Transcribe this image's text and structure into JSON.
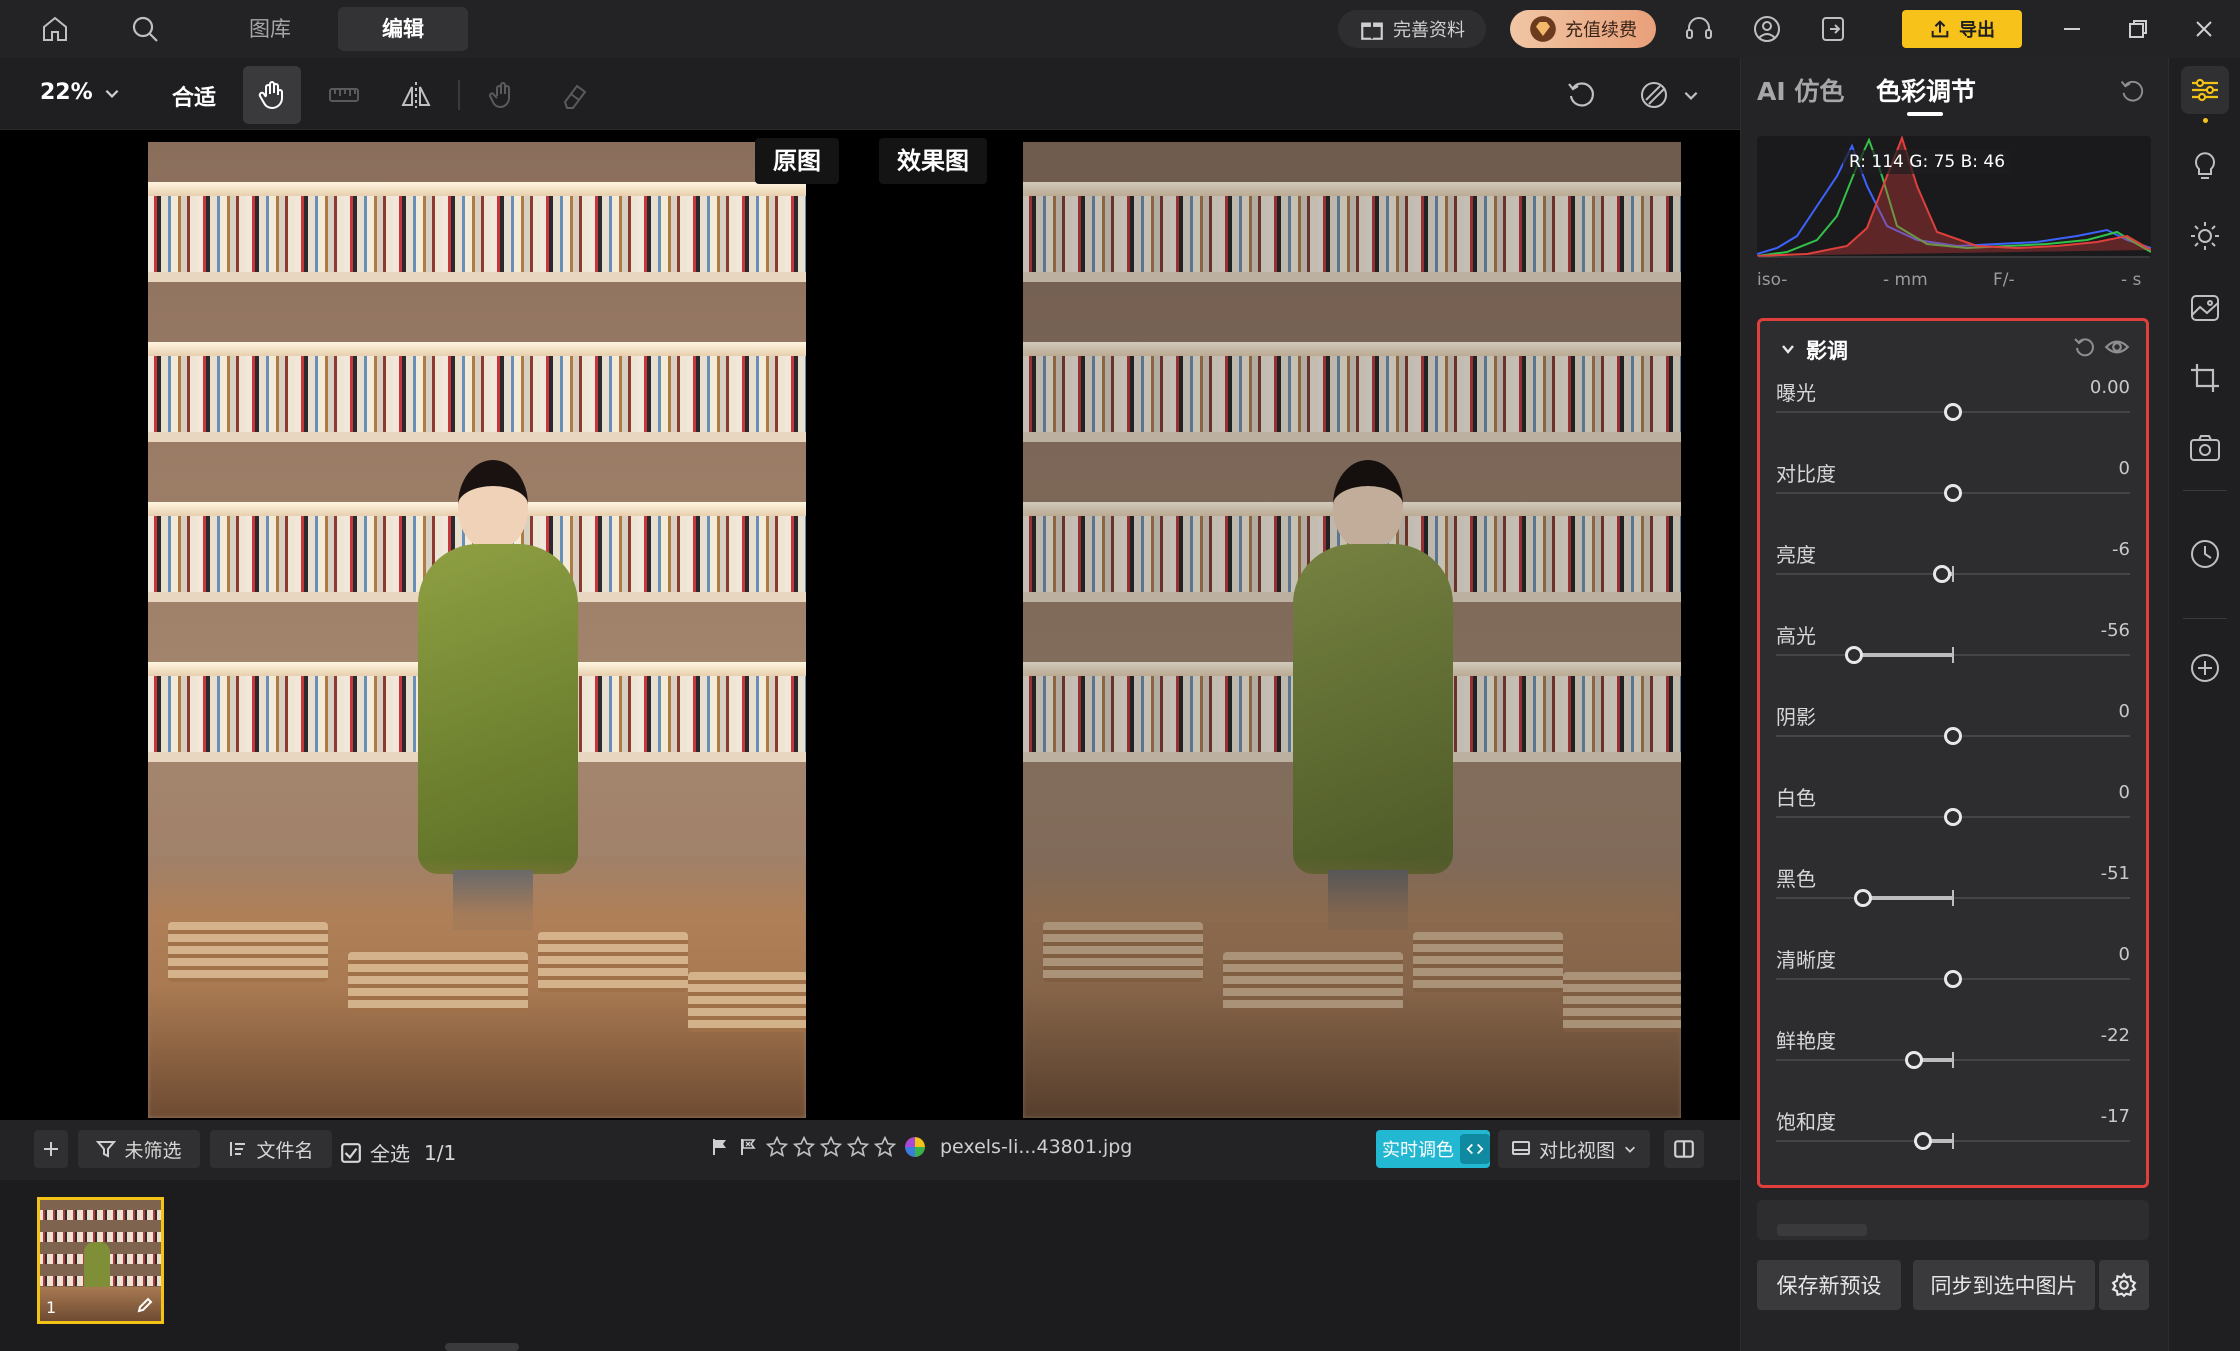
{
  "topbar": {
    "tabs": [
      "图库",
      "编辑"
    ],
    "active_tab": "编辑",
    "complete_profile": "完善资料",
    "recharge": "充值续费",
    "export": "导出",
    "icons": [
      "home-icon",
      "search-icon",
      "gift-icon",
      "gem-icon",
      "headset-icon",
      "user-icon",
      "logout-icon",
      "upload-icon",
      "minimize-icon",
      "restore-icon",
      "close-icon"
    ]
  },
  "toolbar": {
    "zoom": "22%",
    "fit": "合适",
    "icons": [
      "hand-icon",
      "straighten-icon",
      "flip-icon",
      "heal-brush-icon",
      "eraser-icon",
      "undo-icon",
      "mask-icon"
    ]
  },
  "canvas": {
    "label_before": "原图",
    "label_after": "效果图"
  },
  "filmbar": {
    "filter": "未筛选",
    "sort": "文件名",
    "select_all": "全选",
    "count": "1/1",
    "filename": "pexels-li...43801.jpg",
    "rating_stars": 5,
    "realtime_label": "实时调色",
    "compare_view": "对比视图",
    "thumb_index": "1"
  },
  "panel": {
    "tab_ai": "AI 仿色",
    "tab_color": "色彩调节",
    "histogram_readout": "R: 114  G: 75  B: 46",
    "exif": {
      "iso": "iso-",
      "mm": "- mm",
      "f": "F/-",
      "s": "- s"
    },
    "section_title": "影调",
    "sliders": [
      {
        "label": "曝光",
        "value": "0.00",
        "pos": 0.5
      },
      {
        "label": "对比度",
        "value": "0",
        "pos": 0.5
      },
      {
        "label": "亮度",
        "value": "-6",
        "pos": 0.47
      },
      {
        "label": "高光",
        "value": "-56",
        "pos": 0.22
      },
      {
        "label": "阴影",
        "value": "0",
        "pos": 0.5
      },
      {
        "label": "白色",
        "value": "0",
        "pos": 0.5
      },
      {
        "label": "黑色",
        "value": "-51",
        "pos": 0.245
      },
      {
        "label": "清晰度",
        "value": "0",
        "pos": 0.5
      },
      {
        "label": "鲜艳度",
        "value": "-22",
        "pos": 0.39
      },
      {
        "label": "饱和度",
        "value": "-17",
        "pos": 0.415
      }
    ],
    "save_preset": "保存新预设",
    "sync": "同步到选中图片"
  },
  "rail": {
    "icons": [
      "adjust-icon",
      "bulb-icon",
      "sun-icon",
      "image-edit-icon",
      "crop-icon",
      "camera-icon",
      "history-icon",
      "add-icon"
    ]
  },
  "colors": {
    "accent_export": "#f7c31a",
    "realtime_cyan": "#23b8d2",
    "highlight_red": "#e0403d",
    "thumb_border": "#f3c318"
  }
}
